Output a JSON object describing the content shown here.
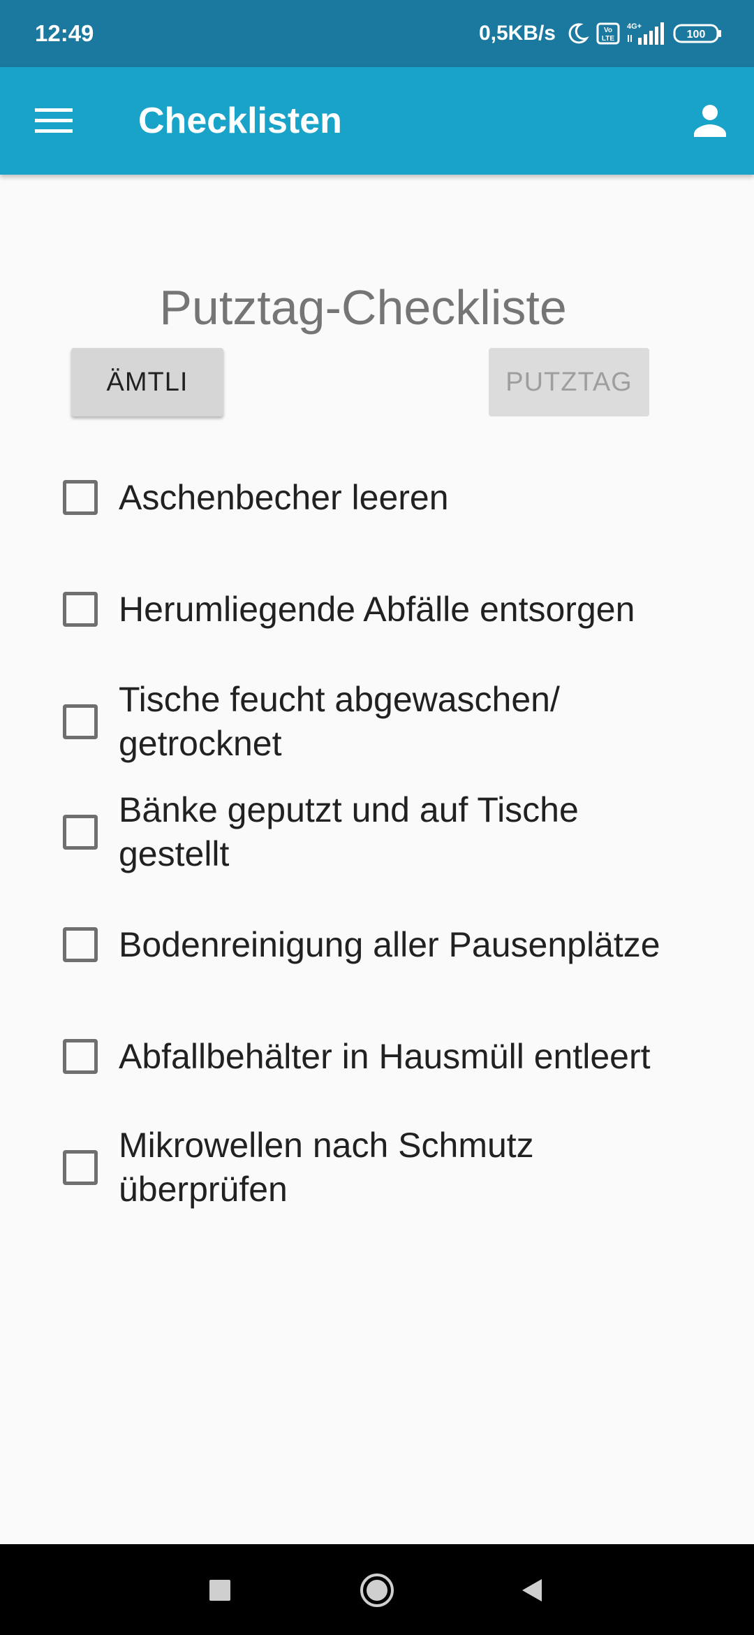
{
  "status_bar": {
    "time": "12:49",
    "network_speed": "0,5KB/s",
    "battery": "100",
    "icons": [
      "moon-icon",
      "volte-icon",
      "signal-4g-icon",
      "battery-icon"
    ]
  },
  "app_bar": {
    "title": "Checklisten",
    "color": "#1aa3c9",
    "icons": [
      "hamburger-menu-icon",
      "account-icon"
    ]
  },
  "page": {
    "heading": "Putztag-Checkliste",
    "buttons": {
      "amtli": "ÄMTLI",
      "putztag": "PUTZTAG"
    },
    "items": [
      {
        "label": "Aschenbecher leeren",
        "checked": false
      },
      {
        "label": "Herumliegende Abfälle entsorgen",
        "checked": false
      },
      {
        "label": "Tische feucht abgewaschen/ getrocknet",
        "checked": false
      },
      {
        "label": "Bänke geputzt und auf Tische gestellt",
        "checked": false
      },
      {
        "label": "Bodenreinigung aller Pausenplätze",
        "checked": false
      },
      {
        "label": "Abfallbehälter in Hausmüll entleert",
        "checked": false
      },
      {
        "label": "Mikrowellen nach Schmutz überprüfen",
        "checked": false
      }
    ]
  },
  "nav_bar": {
    "icons": [
      "recents-square-icon",
      "home-circle-icon",
      "back-triangle-icon"
    ]
  }
}
